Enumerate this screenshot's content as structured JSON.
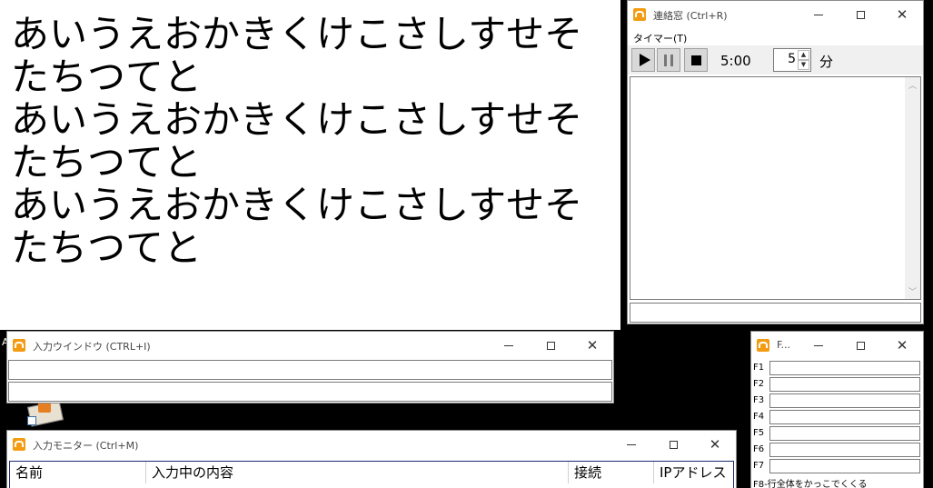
{
  "big_text": {
    "lines": [
      "あいうえおかきくけこさしすせそ",
      "たちつてと",
      "あいうえおかきくけこさしすせそ",
      "たちつてと",
      "あいうえおかきくけこさしすせそ",
      "たちつてと"
    ]
  },
  "contact_window": {
    "title": "連絡窓 (Ctrl+R)",
    "menu": "タイマー(T)",
    "timer_display": "5:00",
    "minutes_value": "5",
    "minutes_unit": "分"
  },
  "input_window": {
    "title": "入力ウインドウ (CTRL+I)"
  },
  "monitor_window": {
    "title": "入力モニター (Ctrl+M)",
    "columns": [
      "名前",
      "入力中の内容",
      "接続",
      "IPアドレス"
    ]
  },
  "fkey_window": {
    "title": "F...",
    "labels": [
      "F1",
      "F2",
      "F3",
      "F4",
      "F5",
      "F6",
      "F7"
    ],
    "footer": "F8-行全体をかっこでくくる"
  },
  "desktop": {
    "left_letter": "A"
  },
  "colors": {
    "app_icon": "#f39c12",
    "desktop": "#000000",
    "button_face": "#d8d8d8"
  }
}
